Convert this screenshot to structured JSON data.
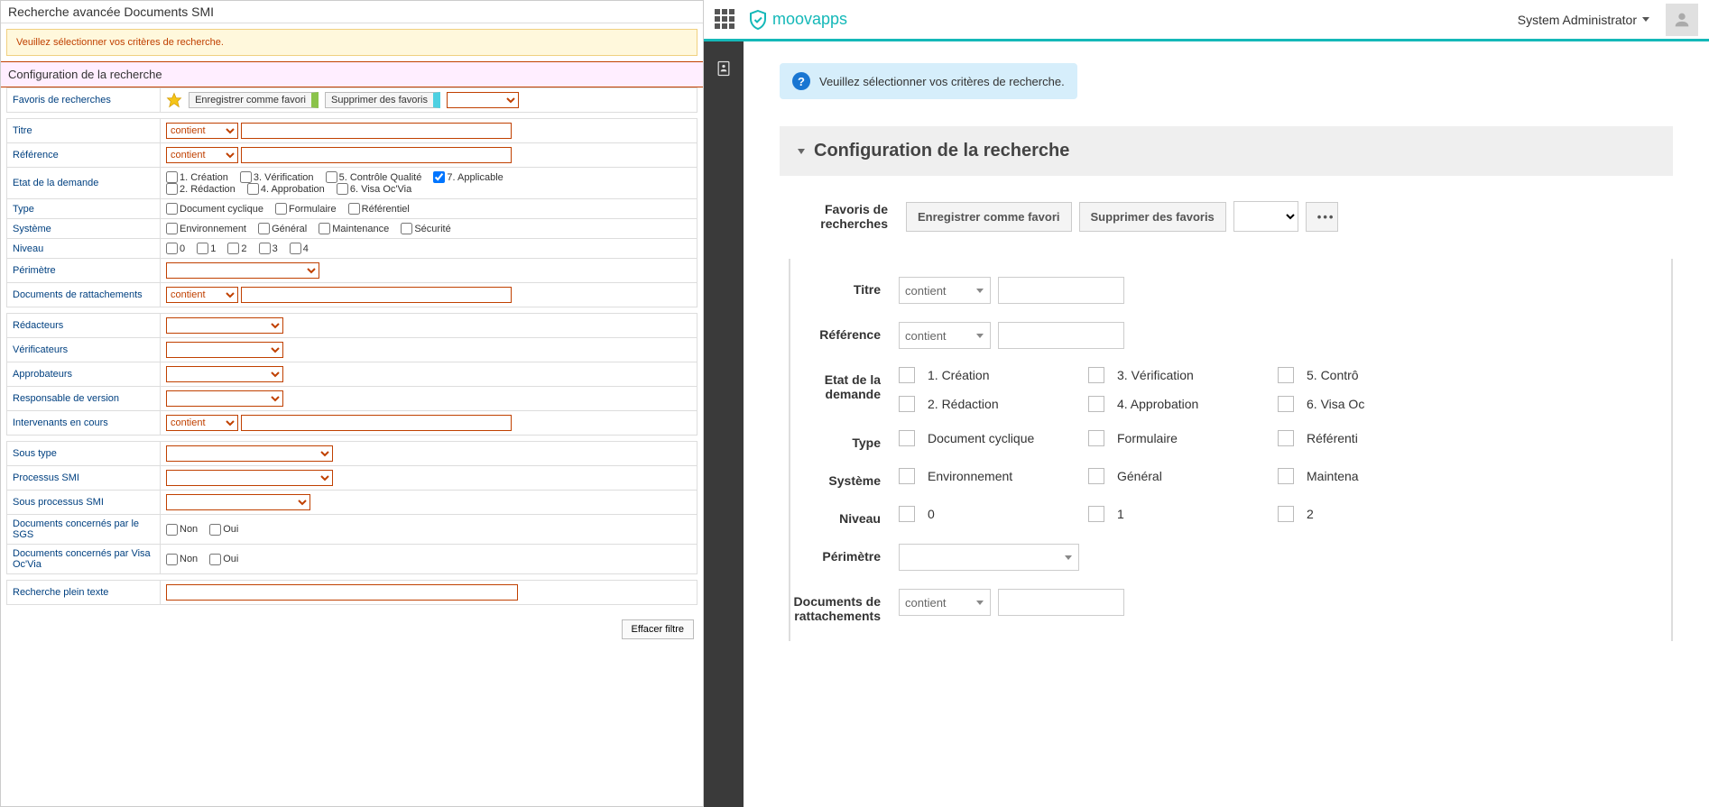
{
  "left": {
    "title": "Recherche avancée Documents SMI",
    "warning": "Veuillez sélectionner vos critères de recherche.",
    "section_title": "Configuration de la recherche",
    "favorites": {
      "label": "Favoris de recherches",
      "save": "Enregistrer comme favori",
      "delete": "Supprimer des favoris"
    },
    "op_contient": "contient",
    "rows": {
      "titre": "Titre",
      "reference": "Référence",
      "etat": "Etat de la demande",
      "type": "Type",
      "systeme": "Système",
      "niveau": "Niveau",
      "perimetre": "Périmètre",
      "docs_ratt": "Documents de rattachements",
      "redacteurs": "Rédacteurs",
      "verificateurs": "Vérificateurs",
      "approbateurs": "Approbateurs",
      "resp_version": "Responsable de version",
      "intervenants": "Intervenants en cours",
      "sous_type": "Sous type",
      "proc_smi": "Processus SMI",
      "sous_proc_smi": "Sous processus SMI",
      "docs_sgs": "Documents concernés par le SGS",
      "docs_visa": "Documents concernés par Visa Oc'Via",
      "plein_texte": "Recherche plein texte"
    },
    "etat_opts": {
      "o1": "1. Création",
      "o2": "2. Rédaction",
      "o3": "3. Vérification",
      "o4": "4. Approbation",
      "o5": "5. Contrôle Qualité",
      "o6": "6. Visa Oc'Via",
      "o7": "7. Applicable"
    },
    "type_opts": {
      "o1": "Document cyclique",
      "o2": "Formulaire",
      "o3": "Référentiel"
    },
    "sys_opts": {
      "o1": "Environnement",
      "o2": "Général",
      "o3": "Maintenance",
      "o4": "Sécurité"
    },
    "niv_opts": {
      "o0": "0",
      "o1": "1",
      "o2": "2",
      "o3": "3",
      "o4": "4"
    },
    "yesno": {
      "non": "Non",
      "oui": "Oui"
    },
    "clear_filter": "Effacer filtre"
  },
  "right": {
    "brand": "moovapps",
    "user": "System Administrator",
    "alert": "Veuillez sélectionner vos critères de recherche.",
    "section_title": "Configuration de la recherche",
    "favorites": {
      "label": "Favoris de recherches",
      "save": "Enregistrer comme favori",
      "delete": "Supprimer des favoris",
      "dots": "•••"
    },
    "op_contient": "contient",
    "rows": {
      "titre": "Titre",
      "reference": "Référence",
      "etat": "Etat de la demande",
      "type": "Type",
      "systeme": "Système",
      "niveau": "Niveau",
      "perimetre": "Périmètre",
      "docs_ratt": "Documents de rattachements"
    },
    "etat_opts": {
      "o1": "1. Création",
      "o2": "2. Rédaction",
      "o3": "3. Vérification",
      "o4": "4. Approbation",
      "o5": "5. Contrô",
      "o6": "6. Visa Oc"
    },
    "type_opts": {
      "o1": "Document cyclique",
      "o2": "Formulaire",
      "o3": "Référenti"
    },
    "sys_opts": {
      "o1": "Environnement",
      "o2": "Général",
      "o3": "Maintena"
    },
    "niv_opts": {
      "o0": "0",
      "o1": "1",
      "o2": "2"
    }
  }
}
